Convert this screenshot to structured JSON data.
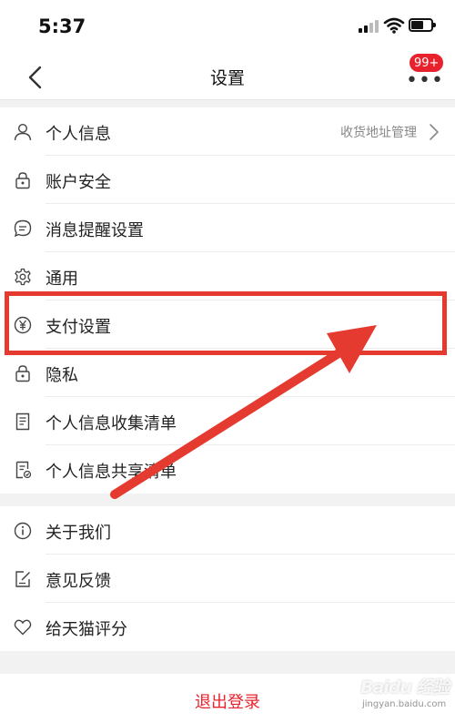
{
  "status_bar": {
    "time": "5:37"
  },
  "nav": {
    "title": "设置",
    "badge": "99+"
  },
  "group1": [
    {
      "icon": "person-icon",
      "label": "个人信息",
      "extra": "收货地址管理"
    },
    {
      "icon": "lock-icon",
      "label": "账户安全"
    },
    {
      "icon": "chat-bubble-icon",
      "label": "消息提醒设置"
    },
    {
      "icon": "gear-icon",
      "label": "通用"
    },
    {
      "icon": "yuan-icon",
      "label": "支付设置"
    },
    {
      "icon": "lock-icon",
      "label": "隐私"
    },
    {
      "icon": "document-list-icon",
      "label": "个人信息收集清单"
    },
    {
      "icon": "document-share-icon",
      "label": "个人信息共享清单"
    }
  ],
  "group2": [
    {
      "icon": "info-icon",
      "label": "关于我们"
    },
    {
      "icon": "edit-note-icon",
      "label": "意见反馈"
    },
    {
      "icon": "heart-icon",
      "label": "给天猫评分"
    }
  ],
  "logout_label": "退出登录",
  "watermark": {
    "logo": "Baidu 经验",
    "url": "jingyan.baidu.com"
  },
  "colors": {
    "accent": "#e8222d",
    "annotation": "#e53a2f",
    "background": "#f2f2f2"
  }
}
